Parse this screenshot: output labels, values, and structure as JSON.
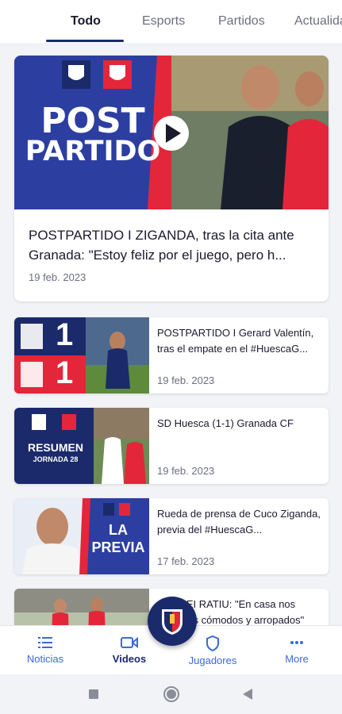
{
  "tabs": [
    {
      "label": "Todo"
    },
    {
      "label": "Esports"
    },
    {
      "label": "Partidos"
    },
    {
      "label": "Actualidad"
    }
  ],
  "featured": {
    "overlay_text_1": "POST",
    "overlay_text_2": "PARTIDO",
    "title": "POSTPARTIDO I ZIGANDA, tras la cita ante Granada: \"Estoy feliz por el juego, pero h...",
    "date": "19 feb. 2023"
  },
  "articles": [
    {
      "title": "POSTPARTIDO I Gerard Valentín, tras el empate en el #HuescaG...",
      "date": "19 feb. 2023",
      "score_home": "1",
      "score_away": "1"
    },
    {
      "title": "SD Huesca (1-1) Granada CF",
      "date": "19 feb. 2023",
      "thumb_text_1": "RESUMEN",
      "thumb_text_2": "JORNADA 28"
    },
    {
      "title": "Rueda de prensa de Cuco Ziganda, previa del #HuescaG...",
      "date": "17 feb. 2023",
      "thumb_text_1": "LA",
      "thumb_text_2": "PREVIA"
    },
    {
      "title": "ANDREI RATIU: \"En casa nos sentimos cómodos y arropados\"",
      "date": ""
    }
  ],
  "bottom_nav": [
    {
      "label": "Noticias",
      "icon": "list-icon"
    },
    {
      "label": "Videos",
      "icon": "video-camera-icon"
    },
    {
      "label": "Jugadores",
      "icon": "shield-icon"
    },
    {
      "label": "More",
      "icon": "more-dots-icon"
    }
  ],
  "colors": {
    "primary": "#1b2a6b",
    "accent_red": "#e4263a",
    "nav_blue": "#3a6ad8",
    "background": "#f2f3f7"
  }
}
